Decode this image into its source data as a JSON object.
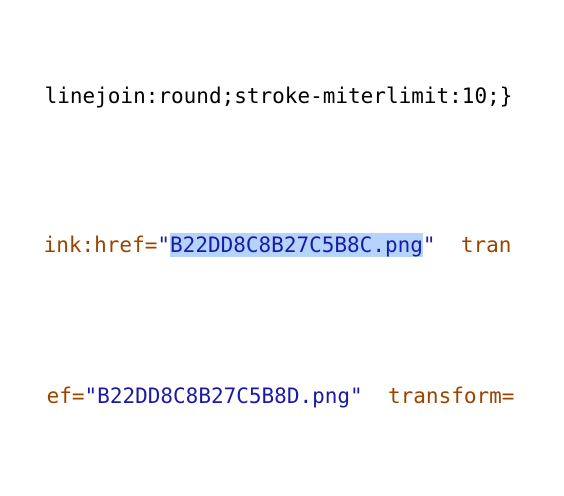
{
  "colors": {
    "attribute": "#994500",
    "value": "#1a1aa6",
    "text": "#000000",
    "selection": "#b4d4fb"
  },
  "lines": [
    {
      "text": "linejoin:round;stroke-miterlimit:10;}"
    },
    {
      "attr": "ink:href=",
      "quote_open": "\"",
      "value": "B22DD8C8B27C5B8C.png",
      "quote_close": "\"",
      "spacer": "  ",
      "next_attr": "tran"
    },
    {
      "attr": "ef=",
      "quote_open": "\"",
      "value": "B22DD8C8B27C5B8D.png",
      "quote_close": "\"",
      "spacer": "  ",
      "next_attr": "transform="
    }
  ]
}
